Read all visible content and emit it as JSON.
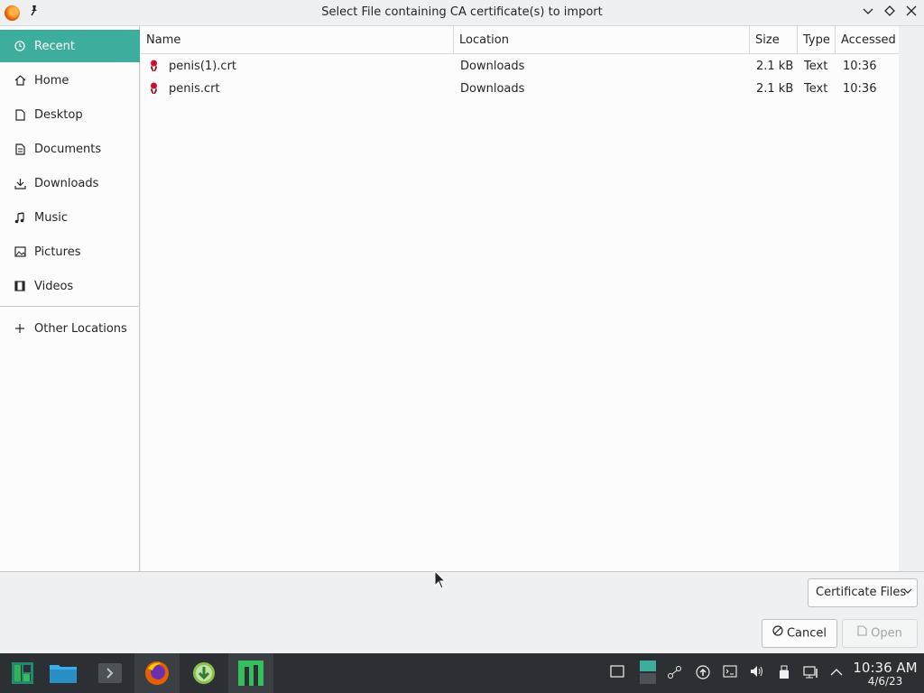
{
  "window": {
    "title": "Select File containing CA certificate(s) to import",
    "pin_icon": "pin-icon",
    "controls": [
      "minimize-icon",
      "maximize-icon",
      "close-icon"
    ]
  },
  "sidebar": {
    "items": [
      {
        "label": "Recent",
        "icon": "clock-icon",
        "active": true
      },
      {
        "label": "Home",
        "icon": "home-icon"
      },
      {
        "label": "Desktop",
        "icon": "desktop-icon"
      },
      {
        "label": "Documents",
        "icon": "documents-icon"
      },
      {
        "label": "Downloads",
        "icon": "downloads-icon"
      },
      {
        "label": "Music",
        "icon": "music-icon"
      },
      {
        "label": "Pictures",
        "icon": "pictures-icon"
      },
      {
        "label": "Videos",
        "icon": "videos-icon"
      }
    ],
    "other_locations": {
      "label": "Other Locations",
      "icon": "plus-icon"
    }
  },
  "filelist": {
    "columns": {
      "name": "Name",
      "location": "Location",
      "size": "Size",
      "type": "Type",
      "accessed": "Accessed"
    },
    "rows": [
      {
        "name": "penis(1).crt",
        "location": "Downloads",
        "size": "2.1 kB",
        "type": "Text",
        "accessed": "10:36"
      },
      {
        "name": "penis.crt",
        "location": "Downloads",
        "size": "2.1 kB",
        "type": "Text",
        "accessed": "10:36"
      }
    ]
  },
  "footer": {
    "filter_value": "Certificate Files",
    "cancel_label": "Cancel",
    "open_label": "Open"
  },
  "taskbar": {
    "apps": [
      "manjaro-menu-icon",
      "file-manager-icon",
      "terminal-icon",
      "firefox-icon",
      "download-manager-icon",
      "manjaro-settings-icon"
    ],
    "clock_time": "10:36 AM",
    "clock_date": "4/6/23"
  },
  "colors": {
    "accent": "#3dae9d",
    "taskbar": "#2c2f33",
    "cert_red": "#c8102e"
  }
}
